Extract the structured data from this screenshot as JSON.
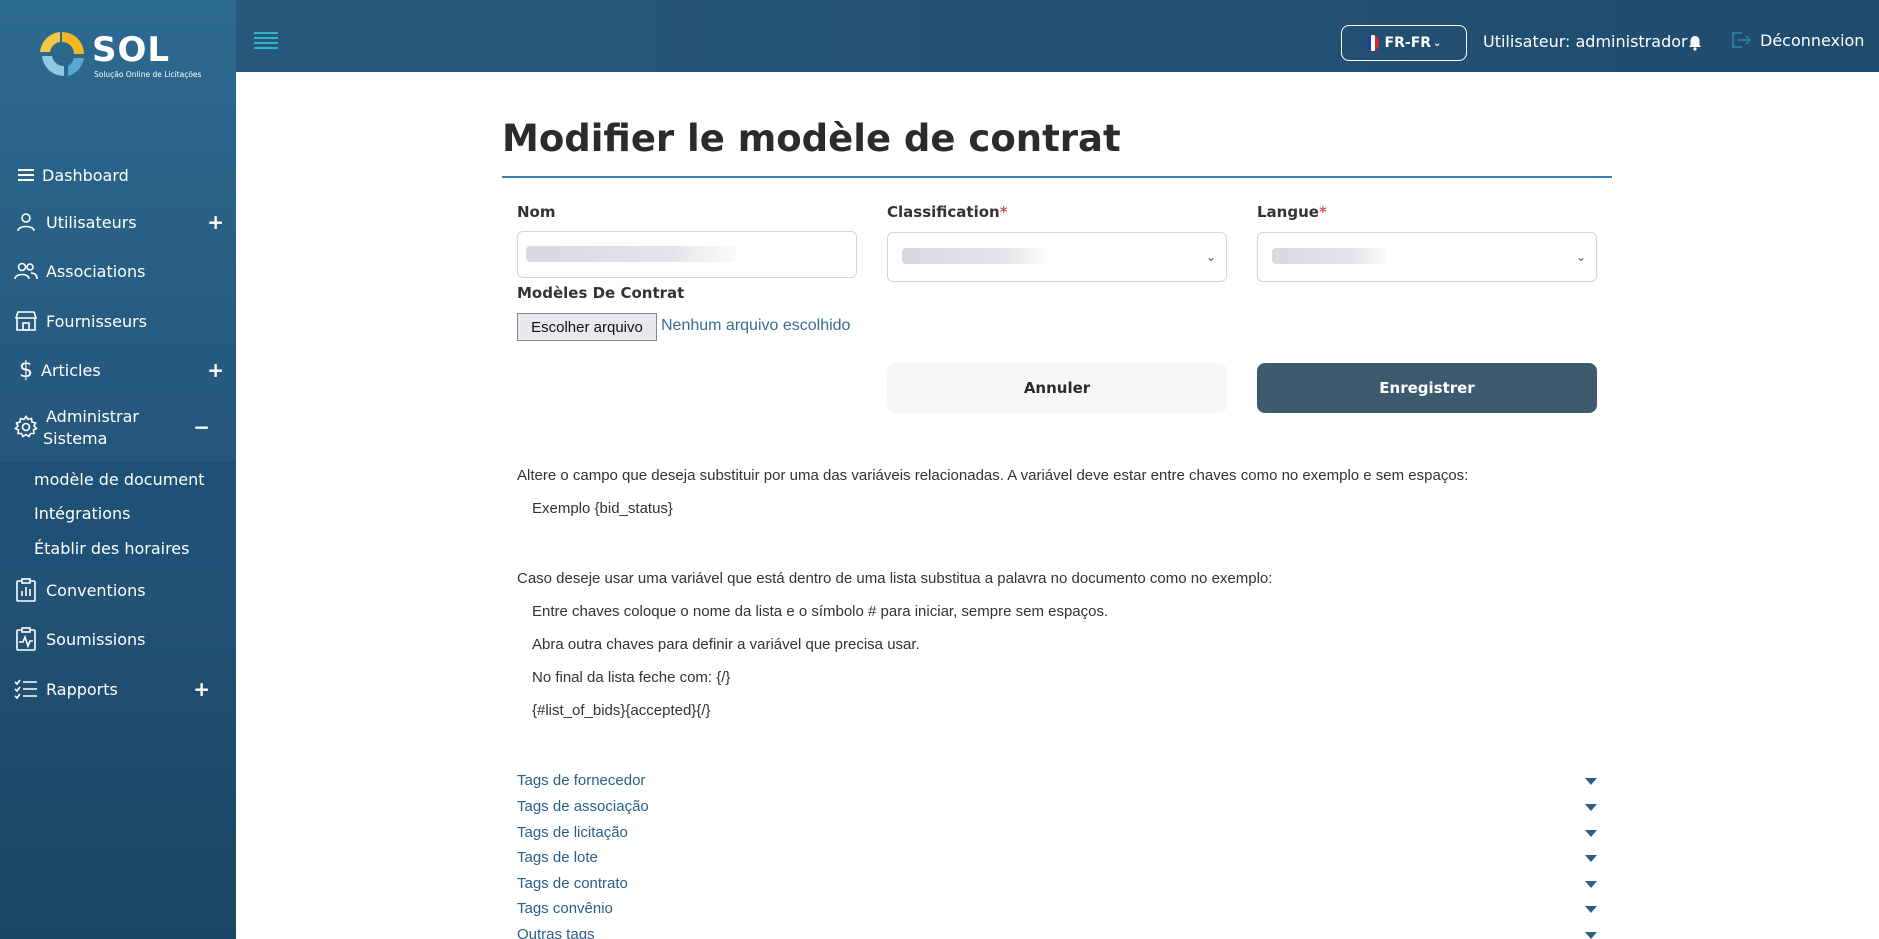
{
  "logo": {
    "word": "SOL",
    "subtitle": "Solução Online de Licitações"
  },
  "sidebar": {
    "items": [
      {
        "label": "Dashboard",
        "icon": "menu-lines-icon"
      },
      {
        "label": "Utilisateurs",
        "icon": "user-icon",
        "toggle": "+"
      },
      {
        "label": "Associations",
        "icon": "users-icon"
      },
      {
        "label": "Fournisseurs",
        "icon": "store-icon"
      },
      {
        "label": "Articles",
        "icon": "dollar-icon",
        "toggle": "+"
      },
      {
        "label": "Administrar Sistema",
        "line1": "Administrar",
        "line2": "Sistema",
        "icon": "gear-icon",
        "toggle": "−"
      },
      {
        "label": "Conventions",
        "icon": "chart-clipboard-icon"
      },
      {
        "label": "Soumissions",
        "icon": "clipboard-pulse-icon"
      },
      {
        "label": "Rapports",
        "icon": "checklist-icon",
        "toggle": "+"
      }
    ],
    "subitems": [
      {
        "label": "modèle de document"
      },
      {
        "label": "Intégrations"
      },
      {
        "label": "Établir des horaires"
      }
    ]
  },
  "topbar": {
    "language": "FR-FR",
    "language_caret": "⌄",
    "user": "Utilisateur: administrador",
    "logout": "Déconnexion"
  },
  "form": {
    "title": "Modifier le modèle de contrat",
    "name_label": "Nom",
    "classification_label": "Classification",
    "language_label": "Langue",
    "required_mark": "*",
    "templates_label": "Modèles De Contrat",
    "file_button": "Escolher arquivo",
    "file_status": "Nenhum arquivo escolhido",
    "cancel": "Annuler",
    "save": "Enregistrer",
    "select_caret": "⌄"
  },
  "help": {
    "line1": "Altere o campo que deseja substituir por uma das variáveis relacionadas. A variável deve estar entre chaves como no exemplo e sem espaços:",
    "example": "Exemplo {bid_status}",
    "line2": "Caso deseje usar uma variável que está dentro de uma lista substitua a palavra no documento como no exemplo:",
    "step1": "Entre chaves coloque o nome da lista e o símbolo # para iniciar, sempre sem espaços.",
    "step2": "Abra outra chaves para definir a variável que precisa usar.",
    "step3": "No final da lista feche com: {/}",
    "step4": "{#list_of_bids}{accepted}{/}"
  },
  "tags": [
    "Tags de fornecedor",
    "Tags de associação",
    "Tags de licitação",
    "Tags de lote",
    "Tags de contrato",
    "Tags convênio",
    "Outras tags"
  ],
  "colors": {
    "sidebar": "#25587c",
    "topbar": "#1f4b6d",
    "accent": "#2fb4c8",
    "save_button": "#3d5a6e",
    "link": "#2a5f88",
    "required": "#d9534f"
  }
}
